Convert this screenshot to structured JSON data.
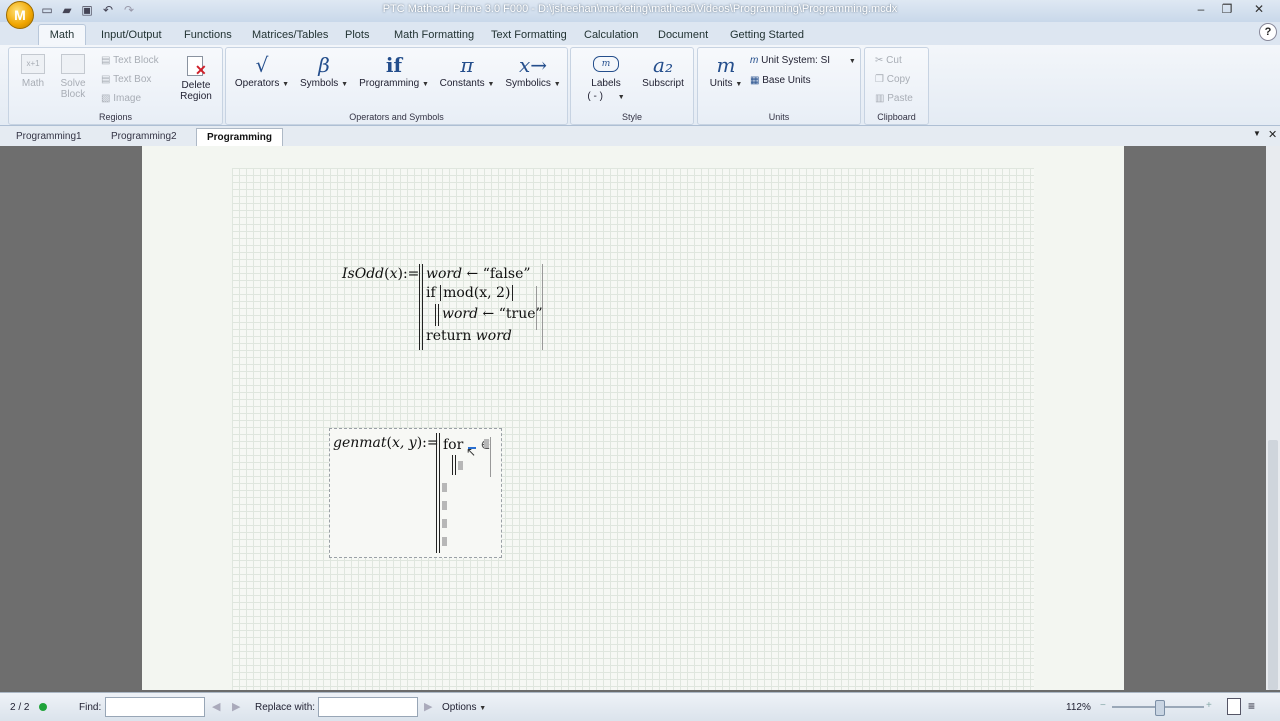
{
  "app": {
    "logo_letter": "M",
    "title": "PTC Mathcad Prime 3.0 F000 - D:\\jsheehan\\marketing\\mathcad\\Videos\\Programming\\Programming.mcdx"
  },
  "ribbon_tabs": [
    "Math",
    "Input/Output",
    "Functions",
    "Matrices/Tables",
    "Plots",
    "Math Formatting",
    "Text Formatting",
    "Calculation",
    "Document",
    "Getting Started"
  ],
  "help_label": "?",
  "ribbon": {
    "regions": {
      "label": "Regions",
      "math": "Math",
      "solve_block": "Solve Block",
      "text_block": "Text Block",
      "text_box": "Text Box",
      "image": "Image",
      "delete_region": "Delete Region"
    },
    "operators": {
      "label": "Operators and Symbols",
      "items": [
        {
          "icon": "√",
          "label": "Operators"
        },
        {
          "icon": "β",
          "label": "Symbols"
        },
        {
          "icon": "if",
          "label": "Programming"
        },
        {
          "icon": "π",
          "label": "Constants"
        },
        {
          "icon": "x→",
          "label": "Symbolics"
        }
      ]
    },
    "style": {
      "label": "Style",
      "labels_btn": "Labels",
      "labels_value": "( - )",
      "subscript_icon": "a₂",
      "subscript": "Subscript"
    },
    "units": {
      "label": "Units",
      "units_btn": "Units",
      "unit_system": "Unit System:",
      "unit_system_value": "SI",
      "base_units": "Base Units"
    },
    "clipboard": {
      "label": "Clipboard",
      "cut": "Cut",
      "copy": "Copy",
      "paste": "Paste"
    }
  },
  "doc_tabs": [
    "Programming1",
    "Programming2",
    "Programming"
  ],
  "worksheet": {
    "isodd": {
      "name": "IsOdd",
      "arg": "x",
      "assign": ":=",
      "line1_var": "word",
      "line1_val": "“false”",
      "if_kw": "if",
      "cond": "mod(x, 2)",
      "line3_var": "word",
      "line3_val": "“true”",
      "return_kw": "return",
      "return_var": "word"
    },
    "genmat": {
      "name": "genmat",
      "args": "x, y",
      "assign": ":=",
      "for_kw": "for",
      "in_sym": "∈"
    }
  },
  "statusbar": {
    "page": "2 / 2",
    "find_label": "Find:",
    "replace_label": "Replace with:",
    "options": "Options",
    "zoom": "112%"
  },
  "colors": {
    "accent": "#244e8c",
    "status_ok": "#1fa33a"
  }
}
